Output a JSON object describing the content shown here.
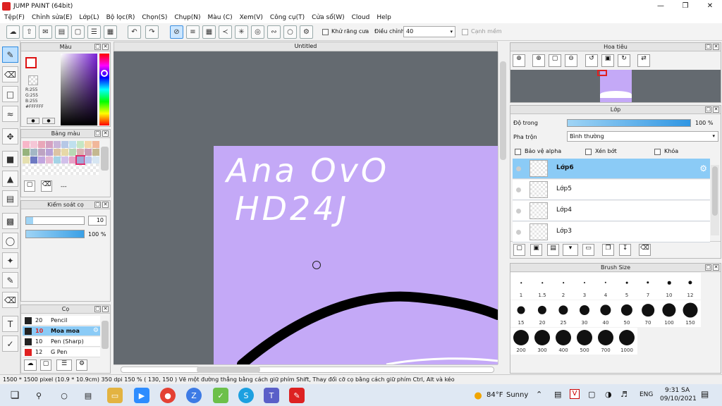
{
  "window": {
    "title": "JUMP PAINT (64bit)"
  },
  "menu": [
    "Tệp(F)",
    "Chỉnh sửa(E)",
    "Lớp(L)",
    "Bộ lọc(R)",
    "Chọn(S)",
    "Chụp(N)",
    "Màu (C)",
    "Xem(V)",
    "Công cụ(T)",
    "Cửa sổ(W)",
    "Cloud",
    "Help"
  ],
  "toolbar": {
    "antialias_label": "Khử răng cưa",
    "adjust_label": "Điều chỉnh",
    "adjust_value": "40",
    "edge_label": "Cạnh mềm"
  },
  "color_panel": {
    "title": "Màu",
    "r": "R:255",
    "g": "G:255",
    "b": "B:255",
    "hex": "#FFFFFF"
  },
  "palette_panel": {
    "title": "Bảng màu",
    "more": "---",
    "swatches": [
      "#f7b6c8",
      "#f5c6d6",
      "#e9a7b9",
      "#d5a0c0",
      "#c9b5d9",
      "#b6c8e6",
      "#bfe0ee",
      "#c5e6c4",
      "#f5d5a8",
      "#f1b79a",
      "#96b37d",
      "#a3b7c5",
      "#bda3c2",
      "#b7a1d6",
      "#dcc3a4",
      "#e7d8a7",
      "#b8d7b4",
      "#dbb0b0",
      "#c79cb6",
      "#c4b890",
      "#e5e0b0",
      "#6d79c2",
      "#c1a6df",
      "#e6b8d1",
      "#a5d3e6",
      "#d1c0ea",
      "#e6a2c7",
      "#9ea7d6",
      "#bcc9ee",
      "#d7e6f2"
    ]
  },
  "brush_control": {
    "title": "Kiểm soát cọ",
    "size": "10",
    "opacity": "100 %",
    "size_fill": 0.12,
    "opacity_fill": 1.0
  },
  "brush_panel": {
    "title": "Cọ",
    "brushes": [
      {
        "size": "20",
        "name": "Pencil",
        "color": "#222222"
      },
      {
        "size": "10",
        "name": "Moa moa",
        "color": "#222222",
        "selected": true
      },
      {
        "size": "10",
        "name": "Pen (Sharp)",
        "color": "#222222"
      },
      {
        "size": "12",
        "name": "G Pen",
        "color": "#e02020"
      }
    ]
  },
  "canvas": {
    "tab_title": "Untitled",
    "text_line1": "Ana OvO",
    "text_line2": "HD24J",
    "bg_color": "#c4a9f7"
  },
  "navigator": {
    "title": "Hoa tiêu"
  },
  "layer_panel": {
    "title": "Lớp",
    "opacity_label": "Độ trong",
    "opacity_value": "100 %",
    "blend_label": "Pha trộn",
    "blend_value": "Bình thường",
    "protect_alpha": "Bảo vệ alpha",
    "clipping": "Xén bớt",
    "lock": "Khóa",
    "layers": [
      {
        "name": "Lớp6",
        "selected": true
      },
      {
        "name": "Lớp5"
      },
      {
        "name": "Lớp4"
      },
      {
        "name": "Lớp3"
      }
    ]
  },
  "brush_size_panel": {
    "title": "Brush Size",
    "sizes": [
      "1",
      "1.5",
      "2",
      "3",
      "4",
      "5",
      "7",
      "10",
      "12",
      "15",
      "20",
      "25",
      "30",
      "40",
      "50",
      "70",
      "100",
      "150",
      "200",
      "300",
      "400",
      "500",
      "700",
      "1000"
    ]
  },
  "status": {
    "text": "1500 * 1500 pixel   (10.9 * 10.9cm)   350 dpi   150 %   ( 130, 150 )   Vẽ một đường thẳng bằng cách giữ phím Shift, Thay đổi cỡ cọ bằng cách giữ phím Ctrl, Alt và kéo"
  },
  "taskbar": {
    "weather_temp": "84°F",
    "weather_text": "Sunny",
    "lang": "ENG",
    "time": "9:31 SA",
    "date": "09/10/2021"
  }
}
